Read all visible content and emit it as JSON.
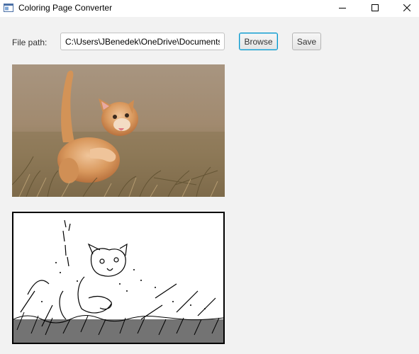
{
  "window": {
    "title": "Coloring Page Converter"
  },
  "form": {
    "path_label": "File path:",
    "path_value": "C:\\Users\\JBenedek\\OneDrive\\Documents",
    "browse_label": "Browse",
    "save_label": "Save"
  },
  "images": {
    "original_subject": "kitten-photo",
    "converted_subject": "kitten-line-art"
  },
  "colors": {
    "window_bg": "#f2f2f2",
    "focus_border": "#0096c9"
  }
}
